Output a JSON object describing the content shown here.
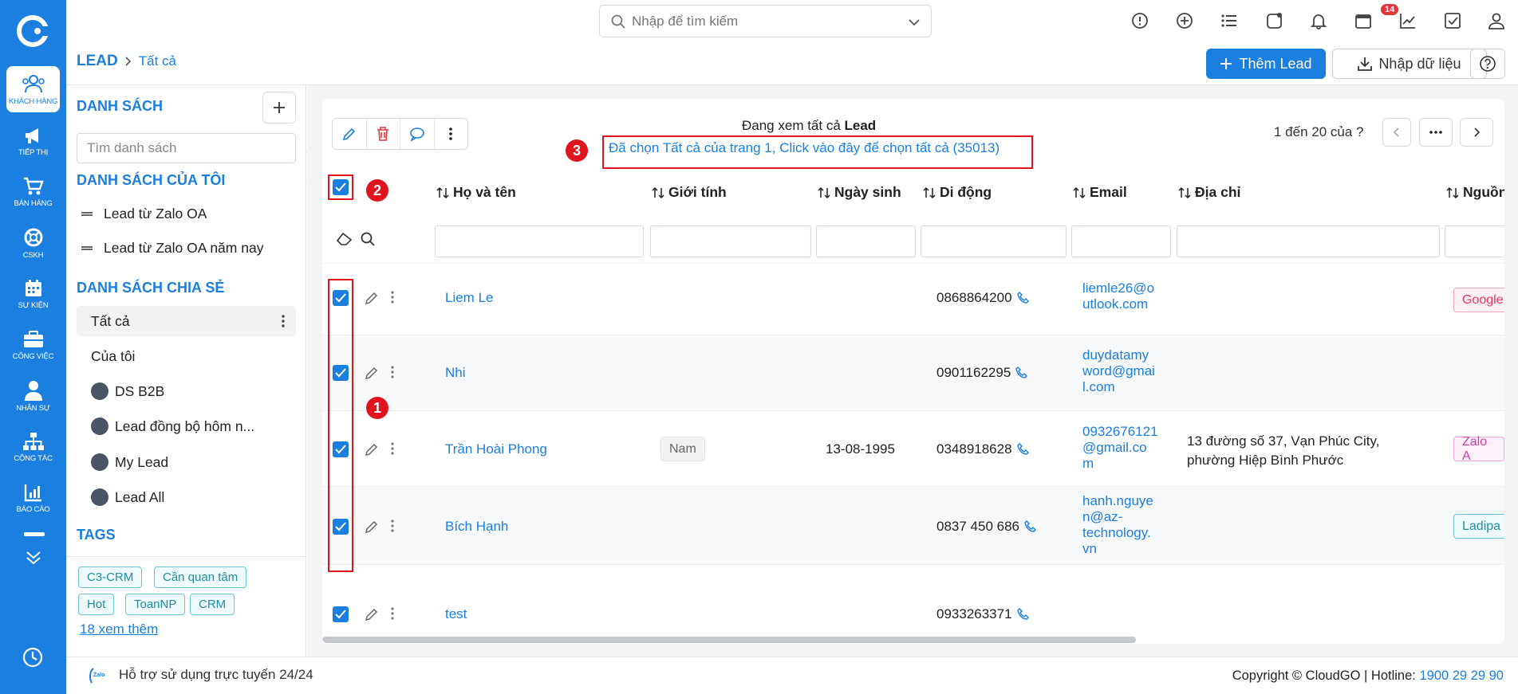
{
  "nav": {
    "items": [
      {
        "label": "KHÁCH HÀNG",
        "icon": "customers-icon"
      },
      {
        "label": "TIẾP THỊ",
        "icon": "megaphone-icon"
      },
      {
        "label": "BÁN HÀNG",
        "icon": "cart-icon"
      },
      {
        "label": "CSKH",
        "icon": "lifebuoy-icon"
      },
      {
        "label": "SỰ KIỆN",
        "icon": "calendar-icon"
      },
      {
        "label": "CÔNG VIỆC",
        "icon": "briefcase-icon"
      },
      {
        "label": "NHÂN SỰ",
        "icon": "person-icon"
      },
      {
        "label": "CỘNG TÁC",
        "icon": "org-chart-icon"
      },
      {
        "label": "BÁO CÁO",
        "icon": "report-icon"
      }
    ]
  },
  "header": {
    "search_placeholder": "Nhập để tìm kiếm",
    "notification_count": "14"
  },
  "breadcrumb": {
    "module": "LEAD",
    "current": "Tất cả"
  },
  "actions": {
    "add_lead": "Thêm Lead",
    "import": "Nhập dữ liệu"
  },
  "sidebar": {
    "title": "DANH SÁCH",
    "search_placeholder": "Tìm danh sách",
    "my_lists_title": "DANH SÁCH CỦA TÔI",
    "my_lists": [
      "Lead từ Zalo OA",
      "Lead từ Zalo OA năm nay"
    ],
    "shared_title": "DANH SÁCH CHIA SẺ",
    "shared": [
      "Tất cả",
      "Của tôi",
      "DS B2B",
      "Lead đồng bộ hôm n...",
      "My Lead",
      "Lead All"
    ],
    "tags_title": "TAGS",
    "tags": [
      "C3-CRM",
      "Cần quan tâm",
      "Hot",
      "ToanNP",
      "CRM"
    ],
    "more_tags": "18 xem thêm"
  },
  "table": {
    "viewing_prefix": "Đang xem tất cả",
    "viewing_module": "Lead",
    "select_all_msg": "Đã chọn Tất cả của trang 1, Click vào đây để chọn tất cả (35013)",
    "pagination": "1 đến 20 của",
    "pagination_q": "?",
    "columns": [
      "Họ và tên",
      "Giới tính",
      "Ngày sinh",
      "Di động",
      "Email",
      "Địa chỉ",
      "Nguồn"
    ],
    "rows": [
      {
        "name": "Liem Le",
        "gender": "",
        "dob": "",
        "mobile": "0868864200",
        "email": [
          "liemle26@o",
          "utlook.com"
        ],
        "address": [],
        "source": "Google"
      },
      {
        "name": "Nhi",
        "gender": "",
        "dob": "",
        "mobile": "0901162295",
        "email": [
          "duydatamy",
          "word@gmai",
          "l.com"
        ],
        "address": [],
        "source": ""
      },
      {
        "name": "Trần Hoài Phong",
        "gender": "Nam",
        "dob": "13-08-1995",
        "mobile": "0348918628",
        "email": [
          "0932676121",
          "@gmail.co",
          "m"
        ],
        "address": [
          "13 đường số 37, Vạn Phúc City,",
          "phường Hiệp Bình Phước"
        ],
        "source": "Zalo A"
      },
      {
        "name": "Bích Hạnh",
        "gender": "",
        "dob": "",
        "mobile": "0837 450 686",
        "email": [
          "hanh.nguye",
          "n@az-",
          "technology.",
          "vn"
        ],
        "address": [],
        "source": "Ladipa"
      },
      {
        "name": "test",
        "gender": "",
        "dob": "",
        "mobile": "0933263371",
        "email": [],
        "address": [],
        "source": ""
      }
    ]
  },
  "annotations": {
    "n1": "1",
    "n2": "2",
    "n3": "3"
  },
  "footer": {
    "support": "Hỗ trợ sử dụng trực tuyến 24/24",
    "zalo": "Zalo",
    "copyright": "Copyright © CloudGO",
    "hotline_label": "Hotline:",
    "hotline": "1900 29 29 90"
  },
  "colors": {
    "primary": "#1b7fe0",
    "annotation": "#e0141c"
  }
}
